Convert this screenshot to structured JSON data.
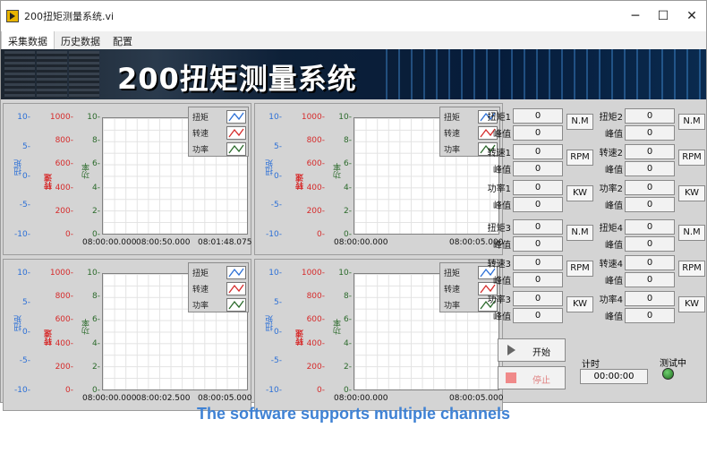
{
  "window": {
    "title": "200扭矩测量系统.vi",
    "min": "─",
    "max": "☐",
    "close": "✕"
  },
  "tabs": [
    "采集数据",
    "历史数据",
    "配置"
  ],
  "banner_title": "200扭矩测量系统",
  "legend": [
    "扭矩",
    "转速",
    "功率"
  ],
  "axis_names": {
    "torque": "扭矩",
    "speed": "转速",
    "power": "功率"
  },
  "ticks": {
    "torque": [
      "10-",
      "5-",
      "0-",
      "-5-",
      "-10-"
    ],
    "speed": [
      "1000-",
      "800-",
      "600-",
      "400-",
      "200-",
      "0-"
    ],
    "power": [
      "10-",
      "8-",
      "6-",
      "4-",
      "2-",
      "0-"
    ]
  },
  "charts": [
    {
      "x_start": "08:00:00.000",
      "x_mid": "08:00:50.000",
      "x_end": "08:01:48.075"
    },
    {
      "x_start": "08:00:00.000",
      "x_mid": "",
      "x_end": "08:00:05.000"
    },
    {
      "x_start": "08:00:00.000",
      "x_mid": "08:00:02.500",
      "x_end": "08:00:05.000"
    },
    {
      "x_start": "08:00:00.000",
      "x_mid": "",
      "x_end": "08:00:05.000"
    }
  ],
  "channels": [
    {
      "torque_label": "扭矩1",
      "speed_label": "转速1",
      "power_label": "功率1"
    },
    {
      "torque_label": "扭矩2",
      "speed_label": "转速2",
      "power_label": "功率2"
    },
    {
      "torque_label": "扭矩3",
      "speed_label": "转速3",
      "power_label": "功率3"
    },
    {
      "torque_label": "扭矩4",
      "speed_label": "转速4",
      "power_label": "功率4"
    }
  ],
  "peak_label": "峰值",
  "value_zero": "0",
  "units": {
    "torque": "N.M",
    "speed": "RPM",
    "power": "KW"
  },
  "controls": {
    "start": "开始",
    "stop": "停止",
    "timer_label": "计时",
    "timer_value": "00:00:00",
    "testing_label": "测试中"
  },
  "caption": "The software supports multiple channels",
  "colors": {
    "torque": "#2b6fd6",
    "speed": "#d62b2b",
    "power": "#2b6a2b",
    "caption": "#3f82d4"
  }
}
